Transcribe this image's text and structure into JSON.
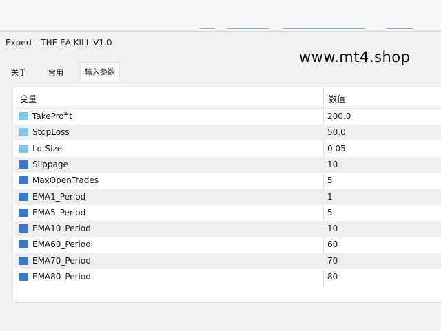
{
  "window": {
    "title": "Expert - THE EA KILL V1.0",
    "watermark": "www.mt4.shop"
  },
  "tabs": [
    {
      "label": "关于",
      "active": false
    },
    {
      "label": "常用",
      "active": false
    },
    {
      "label": "输入参数",
      "active": true
    }
  ],
  "table": {
    "headers": {
      "variable": "变量",
      "value": "数值"
    },
    "rows": [
      {
        "type_icon": "double-type-icon",
        "name": "TakeProfit",
        "value": "200.0"
      },
      {
        "type_icon": "double-type-icon",
        "name": "StopLoss",
        "value": "50.0"
      },
      {
        "type_icon": "double-type-icon",
        "name": "LotSize",
        "value": "0.05"
      },
      {
        "type_icon": "integer-type-icon",
        "name": "Slippage",
        "value": "10"
      },
      {
        "type_icon": "integer-type-icon",
        "name": "MaxOpenTrades",
        "value": "5"
      },
      {
        "type_icon": "integer-type-icon",
        "name": "EMA1_Period",
        "value": "1"
      },
      {
        "type_icon": "integer-type-icon",
        "name": "EMA5_Period",
        "value": "5"
      },
      {
        "type_icon": "integer-type-icon",
        "name": "EMA10_Period",
        "value": "10"
      },
      {
        "type_icon": "integer-type-icon",
        "name": "EMA60_Period",
        "value": "60"
      },
      {
        "type_icon": "integer-type-icon",
        "name": "EMA70_Period",
        "value": "70"
      },
      {
        "type_icon": "integer-type-icon",
        "name": "EMA80_Period",
        "value": "80"
      }
    ]
  }
}
